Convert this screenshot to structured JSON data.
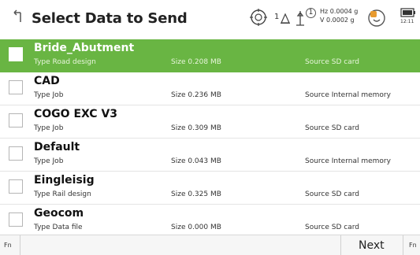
{
  "header": {
    "title": "Select Data to Send",
    "icons": [
      "back-icon",
      "gps-target-icon",
      "level-icon",
      "prism-icon",
      "signal-icon",
      "battery-icon"
    ],
    "level_label": "1",
    "prism_label": "1",
    "hz_label": "Hz 0.0004 g",
    "v_label": "V  0.0002 g",
    "time": "12:11"
  },
  "rows": [
    {
      "name": "Bride_Abutment",
      "type": "Type  Road design",
      "size": "Size  0.208 MB",
      "source": "Source  SD card",
      "selected": true
    },
    {
      "name": "CAD",
      "type": "Type  Job",
      "size": "Size  0.236 MB",
      "source": "Source  Internal memory",
      "selected": false
    },
    {
      "name": "COGO EXC V3",
      "type": "Type  Job",
      "size": "Size  0.309 MB",
      "source": "Source  SD card",
      "selected": false
    },
    {
      "name": "Default",
      "type": "Type  Job",
      "size": "Size  0.043 MB",
      "source": "Source  Internal memory",
      "selected": false
    },
    {
      "name": "Eingleisig",
      "type": "Type  Rail design",
      "size": "Size  0.325 MB",
      "source": "Source  SD card",
      "selected": false
    },
    {
      "name": "Geocom",
      "type": "Type  Data file",
      "size": "Size  0.000 MB",
      "source": "Source  SD card",
      "selected": false
    }
  ],
  "footer": {
    "fn_left": "Fn",
    "fn_right": "Fn",
    "next_label": "Next"
  },
  "colors": {
    "selected_row": "#69b543",
    "battery_accent": "#e89b2f"
  }
}
